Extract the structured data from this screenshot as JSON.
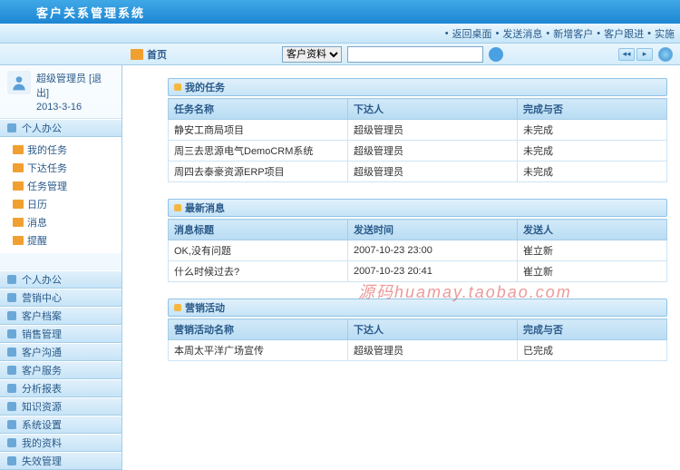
{
  "app": {
    "title": "客户关系管理系统"
  },
  "menu": {
    "items": [
      "返回桌面",
      "发送消息",
      "新增客户",
      "客户跟进",
      "实施"
    ]
  },
  "toolbar": {
    "home": "首页",
    "search_type_selected": "客户资料",
    "search_value": ""
  },
  "user": {
    "role": "超级管理员",
    "logout": "[退出]",
    "date": "2013-3-16"
  },
  "sidebar": {
    "active_section": "个人办公",
    "tree": [
      "我的任务",
      "下达任务",
      "任务管理",
      "日历",
      "消息",
      "提醒"
    ],
    "sections": [
      "个人办公",
      "营销中心",
      "客户档案",
      "销售管理",
      "客户沟通",
      "客户服务",
      "分析报表",
      "知识资源",
      "系统设置",
      "我的资料",
      "失效管理"
    ]
  },
  "panels": [
    {
      "title": "我的任务",
      "headers": [
        "任务名称",
        "下达人",
        "完成与否"
      ],
      "rows": [
        [
          "静安工商局项目",
          "超级管理员",
          "未完成"
        ],
        [
          "周三去思源电气DemoCRM系统",
          "超级管理员",
          "未完成"
        ],
        [
          "周四去泰豪资源ERP项目",
          "超级管理员",
          "未完成"
        ]
      ]
    },
    {
      "title": "最新消息",
      "headers": [
        "消息标题",
        "发送时间",
        "发送人"
      ],
      "rows": [
        [
          "OK,没有问题",
          "2007-10-23 23:00",
          "崔立新"
        ],
        [
          "什么时候过去?",
          "2007-10-23 20:41",
          "崔立新"
        ]
      ]
    },
    {
      "title": "营销活动",
      "headers": [
        "营销活动名称",
        "下达人",
        "完成与否"
      ],
      "rows": [
        [
          "本周太平洋广场宣传",
          "超级管理员",
          "已完成"
        ]
      ]
    }
  ],
  "watermark": {
    "cn": "源码",
    "en": "huamay.taobao.com"
  }
}
